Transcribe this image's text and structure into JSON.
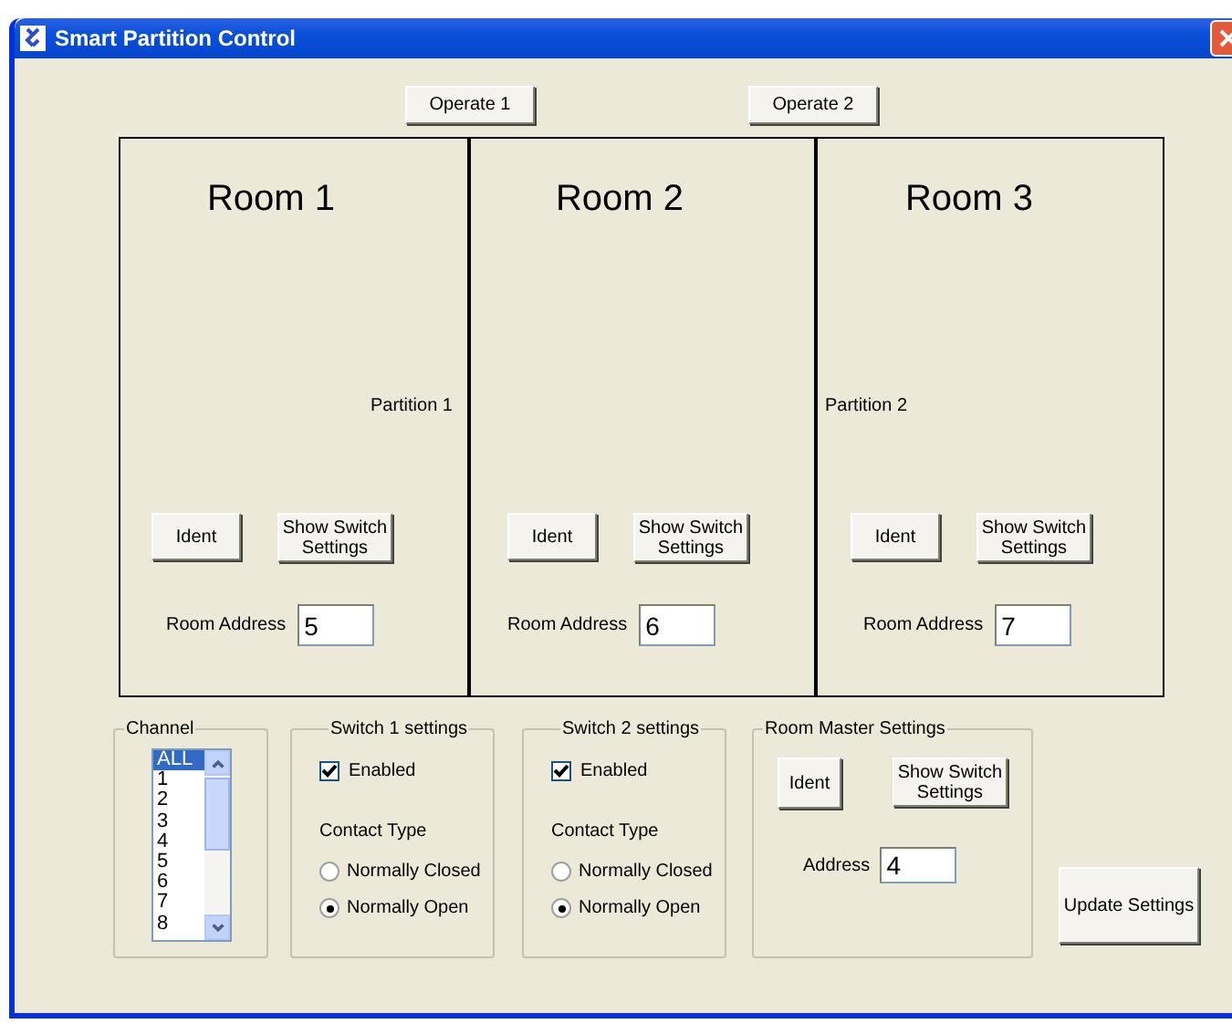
{
  "window": {
    "title": "Smart Partition Control"
  },
  "operate_buttons": [
    "Operate 1",
    "Operate 2"
  ],
  "rooms": [
    {
      "title": "Room 1",
      "partition": {
        "label": "Partition 1",
        "kind": "trailing"
      },
      "ident": "Ident",
      "show_switch": "Show Switch Settings",
      "address_label": "Room Address",
      "address": "5"
    },
    {
      "title": "Room 2",
      "ident": "Ident",
      "show_switch": "Show Switch Settings",
      "address_label": "Room Address",
      "address": "6"
    },
    {
      "title": "Room 3",
      "partition": {
        "label": "Partition 2",
        "kind": "leading"
      },
      "ident": "Ident",
      "show_switch": "Show Switch Settings",
      "address_label": "Room Address",
      "address": "7"
    }
  ],
  "channel": {
    "legend": "Channel",
    "items": [
      {
        "label": "ALL",
        "selected": true
      },
      {
        "label": "1",
        "selected": false
      },
      {
        "label": "2",
        "selected": false
      },
      {
        "label": "3",
        "selected": false
      },
      {
        "label": "4",
        "selected": false
      },
      {
        "label": "5",
        "selected": false
      },
      {
        "label": "6",
        "selected": false
      },
      {
        "label": "7",
        "selected": false
      },
      {
        "label": "8",
        "selected": false
      }
    ]
  },
  "switches": [
    {
      "legend": "Switch 1 settings",
      "enabled": {
        "label": "Enabled",
        "checked": true
      },
      "contact_label": "Contact Type",
      "options": [
        {
          "label": "Normally Closed",
          "selected": false
        },
        {
          "label": "Normally Open",
          "selected": true
        }
      ]
    },
    {
      "legend": "Switch 2 settings",
      "enabled": {
        "label": "Enabled",
        "checked": true
      },
      "contact_label": "Contact Type",
      "options": [
        {
          "label": "Normally Closed",
          "selected": false
        },
        {
          "label": "Normally Open",
          "selected": true
        }
      ]
    }
  ],
  "room_master": {
    "legend": "Room Master Settings",
    "ident": "Ident",
    "show_switch": "Show Switch Settings",
    "address_label": "Address",
    "address": "4"
  },
  "update_button": "Update Settings"
}
